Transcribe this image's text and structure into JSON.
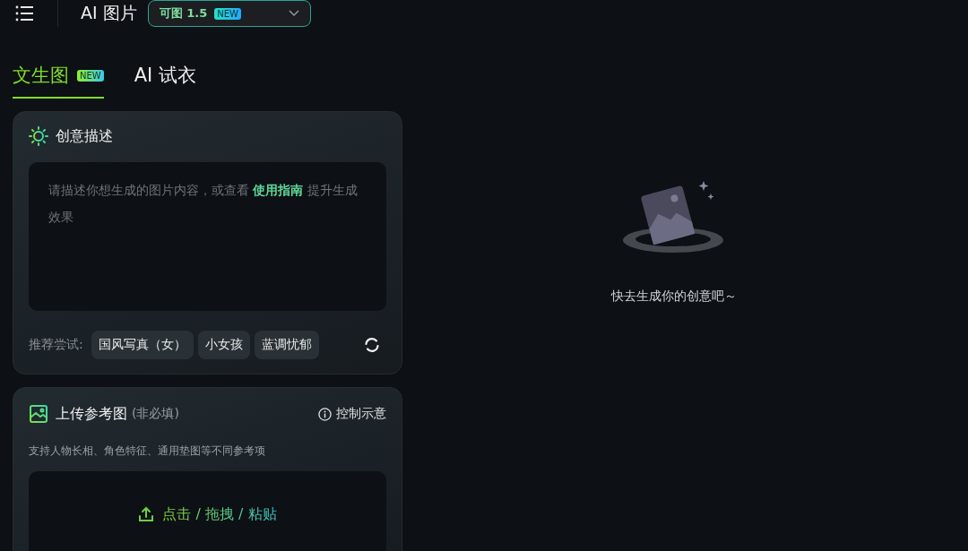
{
  "header": {
    "title": "AI 图片",
    "model": {
      "name": "可图 1.5",
      "badge": "NEW"
    }
  },
  "tabs": [
    {
      "label": "文生图",
      "badge": "NEW",
      "selected": true
    },
    {
      "label": "AI 试衣",
      "selected": false
    }
  ],
  "prompt_card": {
    "title": "创意描述",
    "placeholder_before": "请描述你想生成的图片内容，或查看 ",
    "placeholder_link": "使用指南",
    "placeholder_after": " 提升生成效果",
    "suggest_label": "推荐尝试:",
    "suggestions": [
      "国风写真（女）",
      "小女孩",
      "蓝调忧郁"
    ]
  },
  "upload_card": {
    "title": "上传参考图",
    "optional": "(非必填)",
    "help_link": "控制示意",
    "description": "支持人物长相、角色特征、通用垫图等不同参考项",
    "upload_action": "点击 / 拖拽 / 粘贴"
  },
  "empty_state": {
    "message": "快去生成你的创意吧～"
  }
}
